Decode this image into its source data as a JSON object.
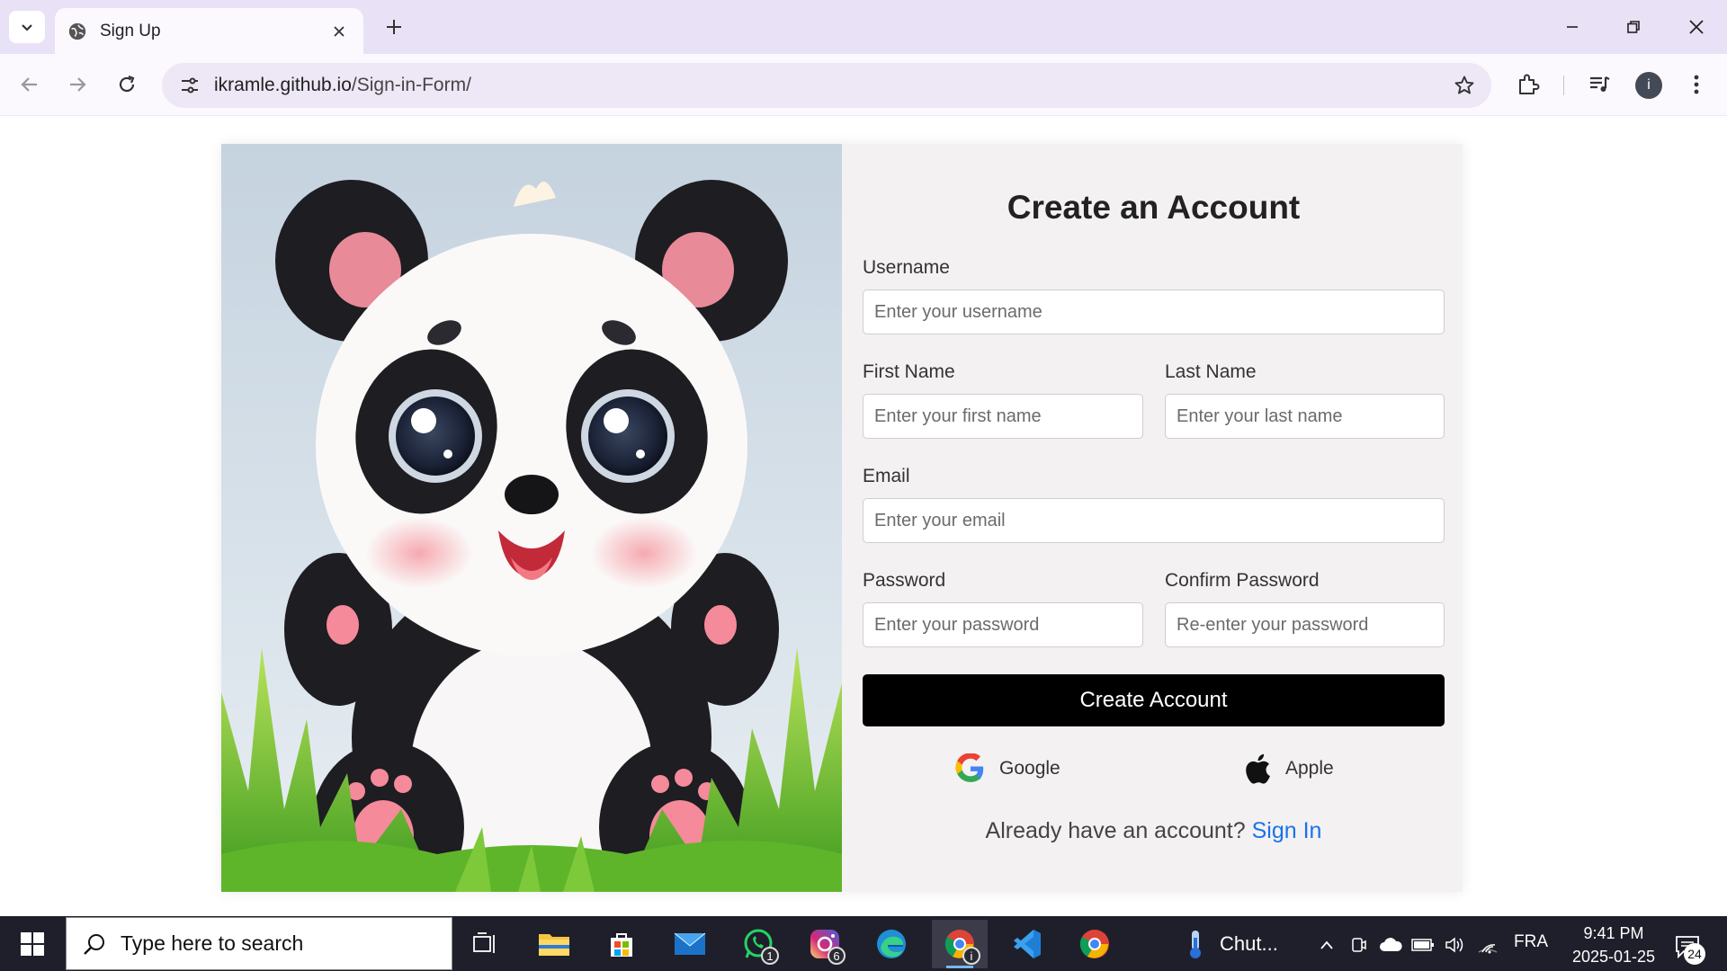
{
  "browser": {
    "tab_title": "Sign Up",
    "url_host": "ikramle.github.io",
    "url_path": "/Sign-in-Form/"
  },
  "form": {
    "title": "Create an Account",
    "username_label": "Username",
    "username_placeholder": "Enter your username",
    "first_name_label": "First Name",
    "first_name_placeholder": "Enter your first name",
    "last_name_label": "Last Name",
    "last_name_placeholder": "Enter your last name",
    "email_label": "Email",
    "email_placeholder": "Enter your email",
    "password_label": "Password",
    "password_placeholder": "Enter your password",
    "confirm_password_label": "Confirm Password",
    "confirm_password_placeholder": "Re-enter your password",
    "submit_label": "Create Account",
    "google_label": "Google",
    "apple_label": "Apple",
    "signin_prompt": "Already have an account?",
    "signin_link": "Sign In"
  },
  "taskbar": {
    "search_placeholder": "Type here to search",
    "whatsapp_badge": "1",
    "instagram_badge": "6",
    "chrome_badge": "i",
    "weather_label": "Chut...",
    "language": "FRA",
    "time": "9:41 PM",
    "date": "2025-01-25",
    "notification_count": "24"
  },
  "colors": {
    "accent_link": "#1a73e8",
    "submit_bg": "#000000",
    "tabstrip": "#e9e1f5",
    "taskbar": "#1f1f2b"
  },
  "icons": [
    "tab-list-icon",
    "globe-icon",
    "close-icon",
    "plus-icon",
    "minimize-icon",
    "restore-icon",
    "back-icon",
    "forward-icon",
    "reload-icon",
    "site-info-icon",
    "star-icon",
    "extensions-icon",
    "media-icon",
    "menu-icon",
    "google-icon",
    "apple-icon",
    "windows-icon",
    "search-icon",
    "task-view-icon",
    "file-explorer-icon",
    "store-icon",
    "mail-icon",
    "whatsapp-icon",
    "instagram-icon",
    "edge-icon",
    "chrome-icon",
    "vscode-icon",
    "thermometer-icon"
  ]
}
